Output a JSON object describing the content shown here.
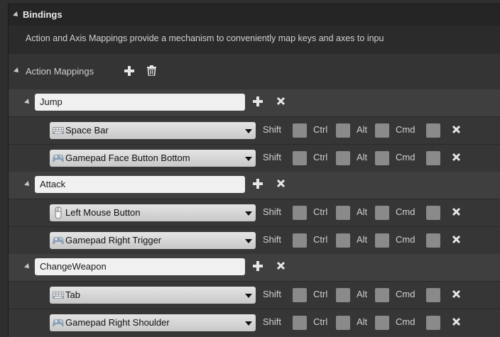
{
  "bindings": {
    "title": "Bindings",
    "description": "Action and Axis Mappings provide a mechanism to conveniently map keys and axes to inpu",
    "action_mappings_label": "Action Mappings"
  },
  "modifiers": {
    "shift": "Shift",
    "ctrl": "Ctrl",
    "alt": "Alt",
    "cmd": "Cmd"
  },
  "actions": [
    {
      "name": "Jump",
      "keys": [
        {
          "label": "Space Bar",
          "icon": "keyboard-icon"
        },
        {
          "label": "Gamepad Face Button Bottom",
          "icon": "gamepad-icon"
        }
      ]
    },
    {
      "name": "Attack",
      "keys": [
        {
          "label": "Left Mouse Button",
          "icon": "mouse-icon"
        },
        {
          "label": "Gamepad Right Trigger",
          "icon": "gamepad-icon"
        }
      ]
    },
    {
      "name": "ChangeWeapon",
      "keys": [
        {
          "label": "Tab",
          "icon": "keyboard-icon"
        },
        {
          "label": "Gamepad Right Shoulder",
          "icon": "gamepad-icon"
        }
      ]
    }
  ],
  "colors": {
    "panel": "#3a3a3a",
    "header": "#252525",
    "checkbox": "#8a8a8a"
  }
}
